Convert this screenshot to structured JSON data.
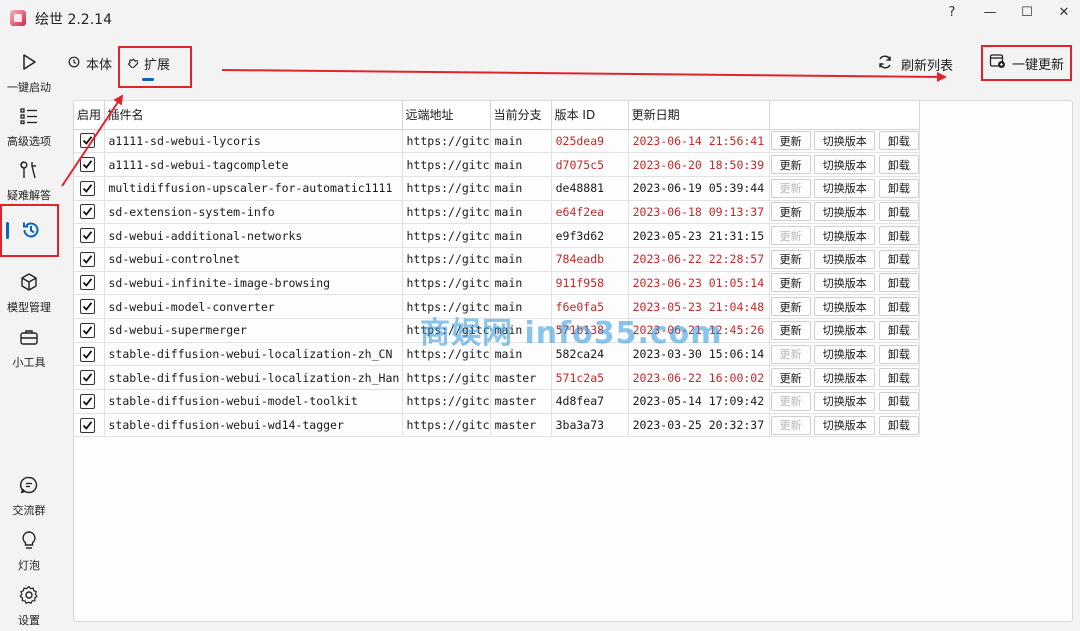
{
  "app": {
    "title": "绘世 2.2.14"
  },
  "window_controls": {
    "help": "?",
    "minimize": "—",
    "maximize": "☐",
    "close": "✕"
  },
  "sidebar": {
    "items": [
      {
        "label": "一键启动",
        "icon": "play-icon"
      },
      {
        "label": "高级选项",
        "icon": "list-icon"
      },
      {
        "label": "疑难解答",
        "icon": "tools-icon"
      },
      {
        "label": "",
        "icon": "history-icon",
        "active": true
      },
      {
        "label": "模型管理",
        "icon": "cube-icon"
      },
      {
        "label": "小工具",
        "icon": "toolbox-icon"
      },
      {
        "label": "交流群",
        "icon": "chat-icon"
      },
      {
        "label": "灯泡",
        "icon": "bulb-icon"
      },
      {
        "label": "设置",
        "icon": "gear-icon"
      }
    ]
  },
  "tabs": {
    "core": "本体",
    "extensions": "扩展"
  },
  "toolbar": {
    "refresh_list": "刷新列表",
    "update_all": "一键更新"
  },
  "table": {
    "headers": {
      "enabled": "启用",
      "name": "插件名",
      "remote": "远端地址",
      "branch": "当前分支",
      "version": "版本 ID",
      "date": "更新日期"
    },
    "buttons": {
      "update": "更新",
      "switch_version": "切换版本",
      "uninstall": "卸载"
    },
    "rows": [
      {
        "name": "a1111-sd-webui-lycoris",
        "remote": "https://gitc",
        "branch": "main",
        "version": "025dea9",
        "date": "2023-06-14 21:56:41",
        "outdated": true
      },
      {
        "name": "a1111-sd-webui-tagcomplete",
        "remote": "https://gitc",
        "branch": "main",
        "version": "d7075c5",
        "date": "2023-06-20 18:50:39",
        "outdated": true
      },
      {
        "name": "multidiffusion-upscaler-for-automatic1111",
        "remote": "https://gitc",
        "branch": "main",
        "version": "de48881",
        "date": "2023-06-19 05:39:44",
        "outdated": false
      },
      {
        "name": "sd-extension-system-info",
        "remote": "https://gitc",
        "branch": "main",
        "version": "e64f2ea",
        "date": "2023-06-18 09:13:37",
        "outdated": true
      },
      {
        "name": "sd-webui-additional-networks",
        "remote": "https://gitc",
        "branch": "main",
        "version": "e9f3d62",
        "date": "2023-05-23 21:31:15",
        "outdated": false
      },
      {
        "name": "sd-webui-controlnet",
        "remote": "https://gitc",
        "branch": "main",
        "version": "784eadb",
        "date": "2023-06-22 22:28:57",
        "outdated": true
      },
      {
        "name": "sd-webui-infinite-image-browsing",
        "remote": "https://gitc",
        "branch": "main",
        "version": "911f958",
        "date": "2023-06-23 01:05:14",
        "outdated": true
      },
      {
        "name": "sd-webui-model-converter",
        "remote": "https://gitc",
        "branch": "main",
        "version": "f6e0fa5",
        "date": "2023-05-23 21:04:48",
        "outdated": true
      },
      {
        "name": "sd-webui-supermerger",
        "remote": "https://gitc",
        "branch": "main",
        "version": "571b138",
        "date": "2023-06-21 12:45:26",
        "outdated": true
      },
      {
        "name": "stable-diffusion-webui-localization-zh_CN",
        "remote": "https://gitc",
        "branch": "main",
        "version": "582ca24",
        "date": "2023-03-30 15:06:14",
        "outdated": false
      },
      {
        "name": "stable-diffusion-webui-localization-zh_Han",
        "remote": "https://gitc",
        "branch": "master",
        "version": "571c2a5",
        "date": "2023-06-22 16:00:02",
        "outdated": true
      },
      {
        "name": "stable-diffusion-webui-model-toolkit",
        "remote": "https://gitc",
        "branch": "master",
        "version": "4d8fea7",
        "date": "2023-05-14 17:09:42",
        "outdated": false
      },
      {
        "name": "stable-diffusion-webui-wd14-tagger",
        "remote": "https://gitc",
        "branch": "master",
        "version": "3ba3a73",
        "date": "2023-03-25 20:32:37",
        "outdated": false
      }
    ]
  },
  "watermark": "商娱网 info35.com",
  "colors": {
    "accent": "#0d62bd",
    "annotation": "#e0242b",
    "outdated_text": "#c62828"
  }
}
